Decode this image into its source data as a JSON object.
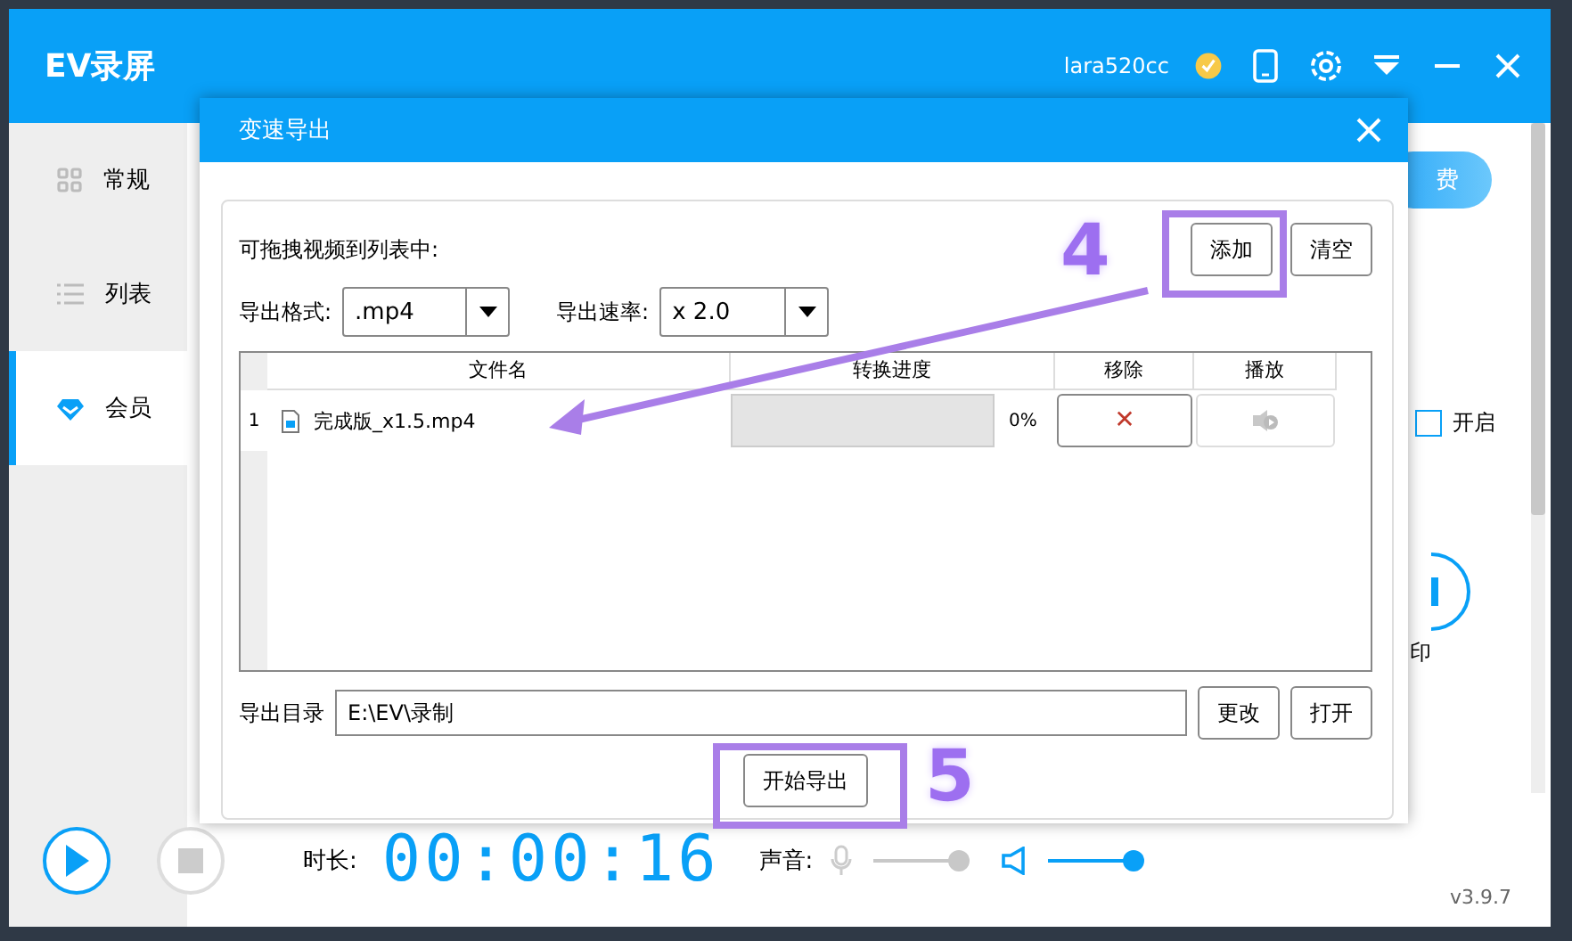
{
  "app": {
    "title": "EV录屏",
    "user": "lara520cc"
  },
  "sidebar": {
    "items": [
      {
        "label": "常规",
        "kind": "grid",
        "selected": false
      },
      {
        "label": "列表",
        "kind": "list",
        "selected": false
      },
      {
        "label": "会员",
        "kind": "gem",
        "selected": true
      }
    ]
  },
  "content": {
    "renew_button": "费",
    "option": {
      "label": "开启",
      "checked": false
    },
    "feature_label": "印"
  },
  "player": {
    "duration_label": "时长:",
    "duration": "00:00:16",
    "sound_label": "声音:",
    "mic": {
      "level": 1,
      "disabled": true
    },
    "speaker": {
      "level": 1,
      "disabled": false
    },
    "version": "v3.9.7"
  },
  "dialog": {
    "title": "变速导出",
    "hint": "可拖拽视频到列表中:",
    "buttons": [
      "添加",
      "清空"
    ],
    "format": {
      "label": "导出格式:",
      "value": ".mp4"
    },
    "speed": {
      "label": "导出速率:",
      "value": "x 2.0"
    },
    "table": {
      "columns": [
        "文件名",
        "转换进度",
        "移除",
        "播放"
      ],
      "rows": [
        {
          "index": "1",
          "file": "完成版_x1.5.mp4",
          "level": 0,
          "progress": "0%",
          "remove": "✕"
        }
      ]
    },
    "output": {
      "label": "导出目录",
      "value": "E:\\EV\\录制",
      "buttons": [
        "更改",
        "打开"
      ]
    },
    "start_button": "开始导出"
  },
  "annotations": [
    {
      "label": "4"
    },
    {
      "label": "5"
    }
  ]
}
